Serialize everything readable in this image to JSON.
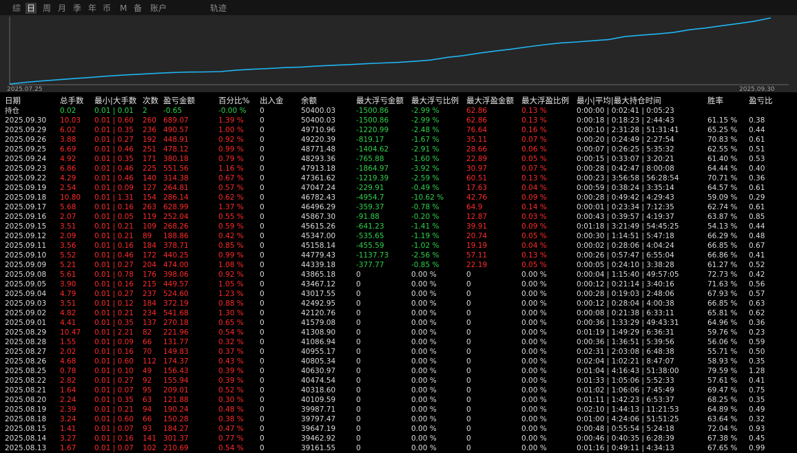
{
  "tabs": [
    {
      "label": "综",
      "active": false
    },
    {
      "label": "日",
      "active": true
    },
    {
      "label": "周",
      "active": false
    },
    {
      "label": "月",
      "active": false
    },
    {
      "label": "季",
      "active": false
    },
    {
      "label": "年",
      "active": false
    },
    {
      "label": "币",
      "active": false
    },
    {
      "label": "M",
      "active": false
    },
    {
      "label": "备",
      "active": false
    },
    {
      "label": "账户",
      "active": false
    },
    {
      "label": "轨迹",
      "active": false
    }
  ],
  "chart_data": {
    "type": "line",
    "x": [
      "2025.07.25",
      "2025.07.28",
      "2025.07.29",
      "2025.07.30",
      "2025.07.31",
      "2025.08.01",
      "2025.08.04",
      "2025.08.05",
      "2025.08.06",
      "2025.08.07",
      "2025.08.08",
      "2025.08.11",
      "2025.08.12",
      "2025.08.13",
      "2025.08.14",
      "2025.08.15",
      "2025.08.18",
      "2025.08.19",
      "2025.08.20",
      "2025.08.21",
      "2025.08.22",
      "2025.08.25",
      "2025.08.26",
      "2025.08.27",
      "2025.08.28",
      "2025.08.29",
      "2025.09.01",
      "2025.09.02",
      "2025.09.03",
      "2025.09.04",
      "2025.09.05",
      "2025.09.08",
      "2025.09.09",
      "2025.09.10",
      "2025.09.11",
      "2025.09.12",
      "2025.09.15",
      "2025.09.16",
      "2025.09.17",
      "2025.09.18",
      "2025.09.19",
      "2025.09.22",
      "2025.09.23",
      "2025.09.24",
      "2025.09.25",
      "2025.09.26",
      "2025.09.29",
      "2025.09.30"
    ],
    "y": [
      36560,
      36900,
      37200,
      37450,
      37700,
      37950,
      38200,
      38420,
      38600,
      38780,
      38950,
      39050,
      39080,
      39161.55,
      39462.92,
      39647.19,
      39797.47,
      39987.71,
      40109.59,
      40318.6,
      40474.54,
      40630.97,
      40805.34,
      40955.17,
      41086.94,
      41308.9,
      41579.08,
      42120.76,
      42492.95,
      43017.55,
      43467.12,
      43865.18,
      44339.18,
      44779.43,
      45158.14,
      45347.0,
      45615.26,
      45867.3,
      46496.29,
      46782.43,
      47047.24,
      47361.62,
      47913.18,
      48293.36,
      48771.48,
      49220.39,
      49710.96,
      50400.03
    ],
    "x_start_label": "2025.07.25",
    "x_end_label": "2025.09.30",
    "color": "#1fb6f2"
  },
  "columns": [
    "日期",
    "总手数",
    "最小|大手数",
    "次数",
    "盈亏金额",
    "百分比%",
    "出入金",
    "余额",
    "最大浮亏金额",
    "最大浮亏比例",
    "最大浮盈金额",
    "最大浮盈比例",
    "最小|平均|最大持仓时间",
    "胜率",
    "盈亏比"
  ],
  "holding": {
    "label": "持仓",
    "lots": "0.02",
    "minmax": "0.01 | 0.01",
    "count": "2",
    "pnl": "-0.65",
    "pct": "-0.00 %",
    "flow": "0",
    "balance": "50400.03",
    "max_float_loss": "-1500.86",
    "max_float_loss_pct": "-2.99 %",
    "max_float_profit": "62.86",
    "max_float_profit_pct": "0.13 %",
    "hold_time": "0:00:00 | 0:02:41 | 0:05:23",
    "win_rate": "",
    "rr": ""
  },
  "rows": [
    [
      "2025.09.30",
      "10.03",
      "0.01 | 0.60",
      "260",
      "689.07",
      "1.39 %",
      "0",
      "50400.03",
      "-1500.86",
      "-2.99 %",
      "62.86",
      "0.13 %",
      "0:00:18 | 0:18:23 | 2:44:43",
      "61.15 %",
      "0.38"
    ],
    [
      "2025.09.29",
      "6.02",
      "0.01 | 0.35",
      "236",
      "490.57",
      "1.00 %",
      "0",
      "49710.96",
      "-1220.99",
      "-2.48 %",
      "76.64",
      "0.16 %",
      "0:00:10 | 2:31:28 | 51:31:41",
      "65.25 %",
      "0.44"
    ],
    [
      "2025.09.26",
      "3.88",
      "0.01 | 0.27",
      "192",
      "448.91",
      "0.92 %",
      "0",
      "49220.39",
      "-819.17",
      "-1.67 %",
      "35.11",
      "0.07 %",
      "0:00:20 | 0:24:49 | 2:27:54",
      "70.83 %",
      "0.61"
    ],
    [
      "2025.09.25",
      "6.69",
      "0.01 | 0.46",
      "251",
      "478.12",
      "0.99 %",
      "0",
      "48771.48",
      "-1404.62",
      "-2.91 %",
      "28.66",
      "0.06 %",
      "0:00:07 | 0:26:25 | 5:35:32",
      "62.55 %",
      "0.51"
    ],
    [
      "2025.09.24",
      "4.92",
      "0.01 | 0.35",
      "171",
      "380.18",
      "0.79 %",
      "0",
      "48293.36",
      "-765.88",
      "-1.60 %",
      "22.89",
      "0.05 %",
      "0:00:15 | 0:33:07 | 3:20:21",
      "61.40 %",
      "0.53"
    ],
    [
      "2025.09.23",
      "6.86",
      "0.01 | 0.46",
      "225",
      "551.56",
      "1.16 %",
      "0",
      "47913.18",
      "-1864.97",
      "-3.92 %",
      "30.97",
      "0.07 %",
      "0:00:28 | 0:42:47 | 8:00:08",
      "64.44 %",
      "0.40"
    ],
    [
      "2025.09.22",
      "4.29",
      "0.01 | 0.46",
      "140",
      "314.38",
      "0.67 %",
      "0",
      "47361.62",
      "-1219.39",
      "-2.59 %",
      "60.51",
      "0.13 %",
      "0:00:23 | 3:56:58 | 56:28:54",
      "70.71 %",
      "0.36"
    ],
    [
      "2025.09.19",
      "2.54",
      "0.01 | 0.09",
      "127",
      "264.81",
      "0.57 %",
      "0",
      "47047.24",
      "-229.91",
      "-0.49 %",
      "17.63",
      "0.04 %",
      "0:00:59 | 0:38:24 | 3:35:14",
      "64.57 %",
      "0.61"
    ],
    [
      "2025.09.18",
      "10.80",
      "0.01 | 1.31",
      "154",
      "286.14",
      "0.62 %",
      "0",
      "46782.43",
      "-4954.7",
      "-10.62 %",
      "42.76",
      "0.09 %",
      "0:00:28 | 0:49:42 | 4:29:43",
      "59.09 %",
      "0.29"
    ],
    [
      "2025.09.17",
      "5.68",
      "0.01 | 0.16",
      "263",
      "628.99",
      "1.37 %",
      "0",
      "46496.29",
      "-359.37",
      "-0.78 %",
      "64.9",
      "0.14 %",
      "0:00:01 | 0:23:34 | 7:12:35",
      "62.74 %",
      "0.61"
    ],
    [
      "2025.09.16",
      "2.07",
      "0.01 | 0.05",
      "119",
      "252.04",
      "0.55 %",
      "0",
      "45867.30",
      "-91.88",
      "-0.20 %",
      "12.87",
      "0.03 %",
      "0:00:43 | 0:39:57 | 4:19:37",
      "63.87 %",
      "0.85"
    ],
    [
      "2025.09.15",
      "3.51",
      "0.01 | 0.21",
      "109",
      "268.26",
      "0.59 %",
      "0",
      "45615.26",
      "-641.23",
      "-1.41 %",
      "39.91",
      "0.09 %",
      "0:01:18 | 3:21:49 | 54:45:25",
      "54.13 %",
      "0.44"
    ],
    [
      "2025.09.12",
      "2.09",
      "0.01 | 0.21",
      "89",
      "188.86",
      "0.42 %",
      "0",
      "45347.00",
      "-535.65",
      "-1.19 %",
      "20.74",
      "0.05 %",
      "0:00:30 | 1:14:51 | 5:47:18",
      "66.29 %",
      "0.48"
    ],
    [
      "2025.09.11",
      "3.56",
      "0.01 | 0.16",
      "184",
      "378.71",
      "0.85 %",
      "0",
      "45158.14",
      "-455.59",
      "-1.02 %",
      "19.19",
      "0.04 %",
      "0:00:02 | 0:28:06 | 4:04:24",
      "66.85 %",
      "0.67"
    ],
    [
      "2025.09.10",
      "5.52",
      "0.01 | 0.46",
      "172",
      "440.25",
      "0.99 %",
      "0",
      "44779.43",
      "-1137.73",
      "-2.56 %",
      "57.11",
      "0.13 %",
      "0:00:26 | 0:57:47 | 6:55:04",
      "66.86 %",
      "0.41"
    ],
    [
      "2025.09.09",
      "5.21",
      "0.01 | 0.27",
      "204",
      "474.00",
      "1.08 %",
      "0",
      "44339.18",
      "-377.77",
      "-0.85 %",
      "22.19",
      "0.05 %",
      "0:00:05 | 0:24:10 | 3:38:28",
      "61.27 %",
      "0.52"
    ],
    [
      "2025.09.08",
      "5.61",
      "0.01 | 0.78",
      "176",
      "398.06",
      "0.92 %",
      "0",
      "43865.18",
      "0",
      "0.00 %",
      "0",
      "0.00 %",
      "0:00:04 | 1:15:40 | 49:57:05",
      "72.73 %",
      "0.42"
    ],
    [
      "2025.09.05",
      "3.90",
      "0.01 | 0.16",
      "215",
      "449.57",
      "1.05 %",
      "0",
      "43467.12",
      "0",
      "0.00 %",
      "0",
      "0.00 %",
      "0:00:12 | 0:21:14 | 3:40:16",
      "71.63 %",
      "0.56"
    ],
    [
      "2025.09.04",
      "4.79",
      "0.01 | 0.27",
      "237",
      "524.60",
      "1.23 %",
      "0",
      "43017.55",
      "0",
      "0.00 %",
      "0",
      "0.00 %",
      "0:00:28 | 0:19:03 | 2:48:06",
      "67.93 %",
      "0.57"
    ],
    [
      "2025.09.03",
      "3.51",
      "0.01 | 0.12",
      "184",
      "372.19",
      "0.88 %",
      "0",
      "42492.95",
      "0",
      "0.00 %",
      "0",
      "0.00 %",
      "0:00:12 | 0:28:04 | 4:00:38",
      "66.85 %",
      "0.63"
    ],
    [
      "2025.09.02",
      "4.82",
      "0.01 | 0.21",
      "234",
      "541.68",
      "1.30 %",
      "0",
      "42120.76",
      "0",
      "0.00 %",
      "0",
      "0.00 %",
      "0:00:08 | 0:21:38 | 6:33:11",
      "65.81 %",
      "0.62"
    ],
    [
      "2025.09.01",
      "4.41",
      "0.01 | 0.35",
      "137",
      "270.18",
      "0.65 %",
      "0",
      "41579.08",
      "0",
      "0.00 %",
      "0",
      "0.00 %",
      "0:00:36 | 1:33:29 | 49:43:31",
      "64.96 %",
      "0.36"
    ],
    [
      "2025.08.29",
      "10.47",
      "0.01 | 2.21",
      "82",
      "221.96",
      "0.54 %",
      "0",
      "41308.90",
      "0",
      "0.00 %",
      "0",
      "0.00 %",
      "0:01:19 | 1:49:29 | 6:36:31",
      "59.76 %",
      "0.23"
    ],
    [
      "2025.08.28",
      "1.55",
      "0.01 | 0.09",
      "66",
      "131.77",
      "0.32 %",
      "0",
      "41086.94",
      "0",
      "0.00 %",
      "0",
      "0.00 %",
      "0:00:36 | 1:36:51 | 5:39:56",
      "56.06 %",
      "0.59"
    ],
    [
      "2025.08.27",
      "2.02",
      "0.01 | 0.16",
      "70",
      "149.83",
      "0.37 %",
      "0",
      "40955.17",
      "0",
      "0.00 %",
      "0",
      "0.00 %",
      "0:02:31 | 2:03:08 | 6:48:38",
      "55.71 %",
      "0.50"
    ],
    [
      "2025.08.26",
      "4.68",
      "0.01 | 0.60",
      "112",
      "174.37",
      "0.43 %",
      "0",
      "40805.34",
      "0",
      "0.00 %",
      "0",
      "0.00 %",
      "0:02:04 | 1:02:21 | 8:47:07",
      "58.93 %",
      "0.35"
    ],
    [
      "2025.08.25",
      "0.78",
      "0.01 | 0.10",
      "49",
      "156.43",
      "0.39 %",
      "0",
      "40630.97",
      "0",
      "0.00 %",
      "0",
      "0.00 %",
      "0:01:04 | 4:16:43 | 51:38:00",
      "79.59 %",
      "1.28"
    ],
    [
      "2025.08.22",
      "2.82",
      "0.01 | 0.27",
      "92",
      "155.94",
      "0.39 %",
      "0",
      "40474.54",
      "0",
      "0.00 %",
      "0",
      "0.00 %",
      "0:01:33 | 1:05:06 | 5:52:33",
      "57.61 %",
      "0.41"
    ],
    [
      "2025.08.21",
      "1.64",
      "0.01 | 0.07",
      "95",
      "209.01",
      "0.52 %",
      "0",
      "40318.60",
      "0",
      "0.00 %",
      "0",
      "0.00 %",
      "0:01:02 | 1:06:06 | 7:45:49",
      "69.47 %",
      "0.75"
    ],
    [
      "2025.08.20",
      "2.24",
      "0.01 | 0.35",
      "63",
      "121.88",
      "0.30 %",
      "0",
      "40109.59",
      "0",
      "0.00 %",
      "0",
      "0.00 %",
      "0:01:11 | 1:42:23 | 6:53:37",
      "68.25 %",
      "0.35"
    ],
    [
      "2025.08.19",
      "2.39",
      "0.01 | 0.21",
      "94",
      "190.24",
      "0.48 %",
      "0",
      "39987.71",
      "0",
      "0.00 %",
      "0",
      "0.00 %",
      "0:02:10 | 1:44:13 | 11:21:53",
      "64.89 %",
      "0.49"
    ],
    [
      "2025.08.18",
      "3.24",
      "0.01 | 0.60",
      "66",
      "150.28",
      "0.38 %",
      "0",
      "39797.47",
      "0",
      "0.00 %",
      "0",
      "0.00 %",
      "0:01:00 | 4:24:06 | 51:51:25",
      "63.64 %",
      "0.32"
    ],
    [
      "2025.08.15",
      "1.41",
      "0.01 | 0.07",
      "93",
      "184.27",
      "0.47 %",
      "0",
      "39647.19",
      "0",
      "0.00 %",
      "0",
      "0.00 %",
      "0:00:48 | 0:55:54 | 5:24:18",
      "72.04 %",
      "0.93"
    ],
    [
      "2025.08.14",
      "3.27",
      "0.01 | 0.16",
      "141",
      "301.37",
      "0.77 %",
      "0",
      "39462.92",
      "0",
      "0.00 %",
      "0",
      "0.00 %",
      "0:00:46 | 0:40:35 | 6:28:39",
      "67.38 %",
      "0.45"
    ],
    [
      "2025.08.13",
      "1.67",
      "0.01 | 0.07",
      "102",
      "210.69",
      "0.54 %",
      "0",
      "39161.55",
      "0",
      "0.00 %",
      "0",
      "0.00 %",
      "0:01:16 | 0:49:11 | 4:34:13",
      "67.65 %",
      "0.99"
    ]
  ]
}
